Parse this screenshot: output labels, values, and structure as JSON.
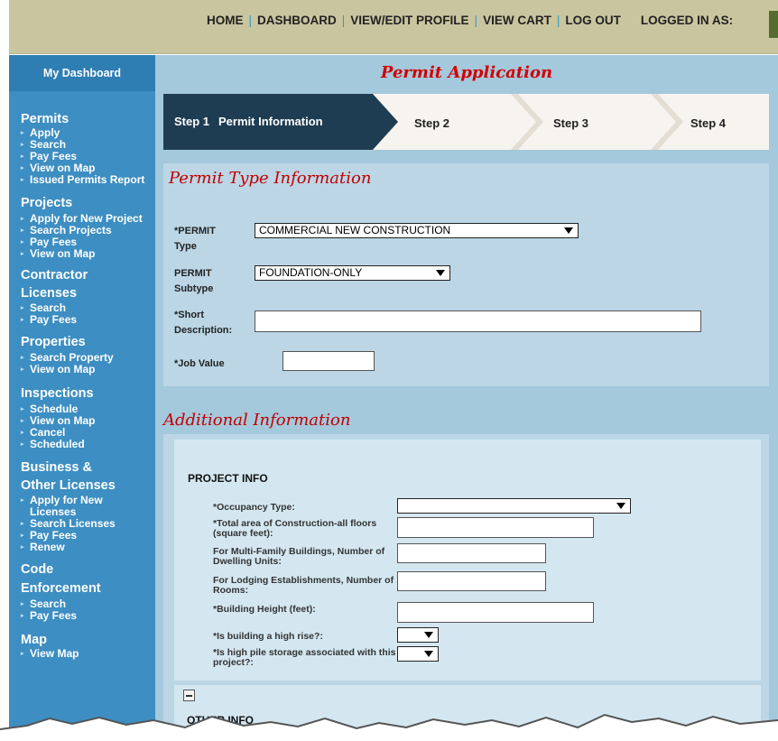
{
  "topnav": {
    "home": "HOME",
    "dashboard": "DASHBOARD",
    "profile": "VIEW/EDIT PROFILE",
    "cart": "VIEW CART",
    "logout": "LOG OUT",
    "logged_in": "LOGGED IN AS:",
    "separator": "|"
  },
  "sidebar": {
    "dashboard": "My Dashboard",
    "sections": {
      "permits": {
        "title": "Permits",
        "items": [
          "Apply",
          "Search",
          "Pay Fees",
          "View on Map",
          "Issued Permits Report"
        ]
      },
      "projects": {
        "title": "Projects",
        "items": [
          "Apply for New Project",
          "Search Projects",
          "Pay Fees",
          "View on Map"
        ]
      },
      "contractor": {
        "title_line1": "Contractor",
        "title_line2": "Licenses",
        "items": [
          "Search",
          "Pay Fees"
        ]
      },
      "properties": {
        "title": "Properties",
        "items": [
          "Search Property",
          "View on Map"
        ]
      },
      "inspections": {
        "title": "Inspections",
        "items": [
          "Schedule",
          "View on Map",
          "Cancel",
          "Scheduled"
        ]
      },
      "business": {
        "title_line1": "Business &",
        "title_line2": "Other Licenses",
        "items": [
          "Apply for New Licenses",
          "Search Licenses",
          "Pay Fees",
          "Renew"
        ]
      },
      "code": {
        "title_line1": "Code",
        "title_line2": "Enforcement",
        "items": [
          "Search",
          "Pay Fees"
        ]
      },
      "map": {
        "title": "Map",
        "items": [
          "View Map"
        ]
      }
    }
  },
  "main": {
    "title": "Permit Application",
    "steps": {
      "step1_num": "Step 1",
      "step1_label": "Permit Information",
      "step2": "Step 2",
      "step3": "Step 3",
      "step4": "Step 4"
    },
    "permit_type": {
      "heading": "Permit Type Information",
      "type_label_1": "*PERMIT",
      "type_label_2": "Type",
      "type_value": "COMMERCIAL NEW CONSTRUCTION",
      "subtype_label_1": "PERMIT",
      "subtype_label_2": "Subtype",
      "subtype_value": "FOUNDATION-ONLY",
      "desc_label_1": "*Short",
      "desc_label_2": "Description:",
      "desc_value": "",
      "job_label": "*Job Value",
      "job_value": ""
    },
    "additional": {
      "heading": "Additional Information",
      "project_info": "PROJECT INFO",
      "fields": {
        "occupancy": "*Occupancy Type:",
        "total_area": "*Total area of Construction-all floors (square feet):",
        "multi_family": "For Multi-Family Buildings, Number of Dwelling Units:",
        "lodging": "For Lodging Establishments, Number of Rooms:",
        "height": "*Building Height (feet):",
        "high_rise": "*Is building a high rise?:",
        "pile_storage": "*Is high pile storage associated with this project?:"
      },
      "other_info": "OTHER INFO"
    }
  }
}
